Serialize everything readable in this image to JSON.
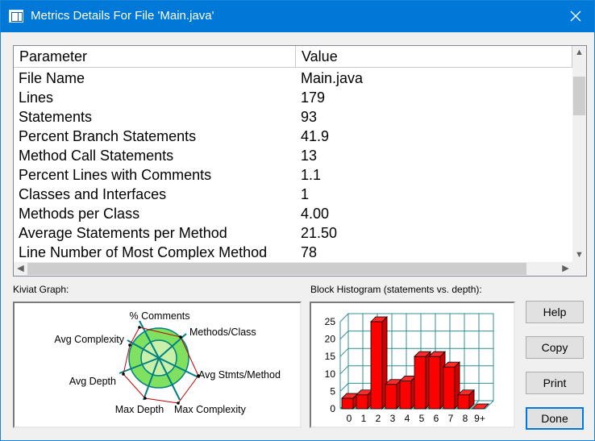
{
  "window": {
    "title": "Metrics Details For File 'Main.java'"
  },
  "table": {
    "columns": [
      "Parameter",
      "Value"
    ],
    "rows": [
      [
        "File Name",
        "Main.java"
      ],
      [
        "Lines",
        "179"
      ],
      [
        "Statements",
        "93"
      ],
      [
        "Percent Branch Statements",
        "41.9"
      ],
      [
        "Method Call Statements",
        "13"
      ],
      [
        "Percent Lines with Comments",
        "1.1"
      ],
      [
        "Classes and Interfaces",
        "1"
      ],
      [
        "Methods per Class",
        "4.00"
      ],
      [
        "Average Statements per Method",
        "21.50"
      ],
      [
        "Line Number of Most Complex Method",
        "78"
      ]
    ]
  },
  "kiviat": {
    "label": "Kiviat Graph:",
    "axes": [
      "% Comments",
      "Methods/Class",
      "Avg Stmts/Method",
      "Max Complexity",
      "Max Depth",
      "Avg Depth",
      "Avg Complexity"
    ]
  },
  "histogram": {
    "label": "Block Histogram (statements vs. depth):"
  },
  "chart_data": {
    "type": "bar",
    "title": "Block Histogram (statements vs. depth):",
    "categories": [
      "0",
      "1",
      "2",
      "3",
      "4",
      "5",
      "6",
      "7",
      "8",
      "9+"
    ],
    "values": [
      3,
      4,
      25,
      7,
      8,
      15,
      15,
      12,
      4,
      0
    ],
    "ylim": [
      0,
      25
    ],
    "yticks": [
      "0",
      "5",
      "10",
      "15",
      "20",
      "25"
    ],
    "grid": true,
    "bar_color": "#ff0000"
  },
  "buttons": {
    "help": "Help",
    "copy": "Copy",
    "print": "Print",
    "done": "Done"
  },
  "colors": {
    "titlebar": "#0078d7",
    "kiviat_ring": "#80e060",
    "kiviat_center": "#c8f0a8",
    "kiviat_spokes": "#008080",
    "kiviat_polygon": "#c00000",
    "grid": "#2f8f8f"
  }
}
